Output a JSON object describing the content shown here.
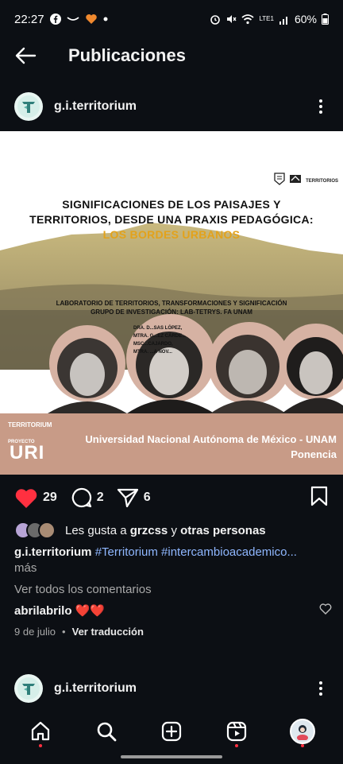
{
  "status_bar": {
    "time": "22:27",
    "battery": "60%",
    "network": "LTE1",
    "icons": [
      "facebook-icon",
      "messaging-icon",
      "heart-app-icon",
      "alarm-icon",
      "mute-icon",
      "wifi-icon",
      "signal-icon",
      "battery-icon"
    ]
  },
  "header": {
    "title": "Publicaciones"
  },
  "post": {
    "username": "g.i.territorium",
    "image": {
      "logos_text": "TERRITORIOS",
      "title_line1": "SIGNIFICACIONES DE LOS PAISAJES Y",
      "title_line2": "TERRITORIOS, DESDE UNA PRAXIS PEDAGÓGICA:",
      "title_accent": "LOS BORDES URBANOS",
      "lab_line1": "LABORATORIO DE TERRITORIOS, TRANSFORMACIONES Y SIGNIFICACIÓN",
      "lab_line2": "GRUPO DE INVESTIGACIÓN: LAB-TETRYS. FA UNAM",
      "names": [
        "DRA. D...SAS LÓPEZ,",
        "MTRA. G...EZ CÁRDE...",
        "MSC...CAJARDO,",
        "MTRA. ...A NOV..."
      ],
      "band_logo_text": "TERRITORIUM",
      "band_project": "PROYECTO",
      "band_uri": "URI",
      "university": "Universidad Nacional Autónoma de México - UNAM",
      "event_type": "Ponencia",
      "band_color": "#c89b87",
      "accent_color": "#e3a21b"
    },
    "likes_count": "29",
    "comments_count": "2",
    "shares_count": "6",
    "liked_by_prefix": "Les gusta a",
    "liked_by_user": "grzcss",
    "liked_by_suffix": "y",
    "liked_by_others": "otras personas",
    "caption_user": "g.i.territorium",
    "caption_tags": "#Territorium #intercambioacademico...",
    "caption_more": "más",
    "view_comments": "Ver todos los comentarios",
    "comment_user": "abrilabrilo",
    "comment_text": "❤️❤️",
    "date": "9 de julio",
    "translate": "Ver traducción",
    "like_color": "#ff3040"
  },
  "next_post": {
    "username": "g.i.territorium"
  },
  "bottom_nav": {
    "items": [
      "home-icon",
      "search-icon",
      "create-icon",
      "reels-icon",
      "profile-avatar"
    ]
  }
}
